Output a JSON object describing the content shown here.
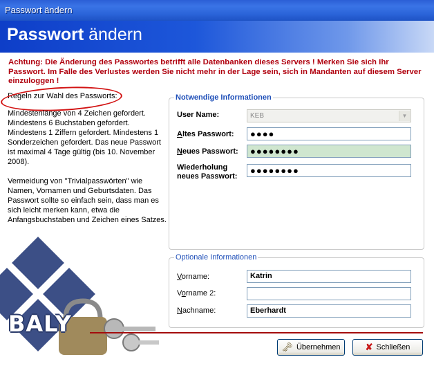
{
  "window": {
    "title": "Passwort ändern"
  },
  "header": {
    "title_bold": "Passwort",
    "title_rest": " ändern"
  },
  "warning": "Achtung: Die Änderung des Passwortes betrifft alle Datenbanken dieses Servers ! Merken Sie sich Ihr Passwort. Im Falle des Verlustes werden Sie nicht mehr in der Lage sein, sich in Mandanten auf diesem Server einzuloggen !",
  "rules": {
    "heading": "Regeln zur Wahl des Passworts:",
    "paragraph1": "Mindestenlänge von 4 Zeichen gefordert. Mindestens 6 Buchstaben gefordert. Mindestens 1 Ziffern gefordert. Mindestens 1 Sonderzeichen gefordert. Das neue Passwort ist maximal 4 Tage gültig (bis 10. November 2008).",
    "paragraph2": "Vermeidung von \"Trivialpasswörten\" wie Namen, Vornamen und Geburtsdaten. Das Passwort sollte so einfach sein, dass man es sich leicht merken kann, etwa die Anfangsbuchstaben und Zeichen eines Satzes."
  },
  "required": {
    "legend": "Notwendige Informationen",
    "username_label": "User Name:",
    "username_value": "KEB",
    "old_password_label": "Altes Passwort:",
    "old_password_mask": "●●●●",
    "new_password_label": "Neues Passwort:",
    "new_password_mask": "●●●●●●●●",
    "repeat_label_line1": "Wiederholung",
    "repeat_label_line2": "neues Passwort:",
    "repeat_mask": "●●●●●●●●"
  },
  "optional": {
    "legend": "Optionale Informationen",
    "firstname_label": "Vorname:",
    "firstname_value": "Katrin",
    "firstname2_label": "Vorname 2:",
    "firstname2_value": "",
    "lastname_label": "Nachname:",
    "lastname_value": "Eberhardt"
  },
  "buttons": {
    "apply_label": "Übernehmen",
    "close_label": "Schließen"
  },
  "logo": {
    "text": "BALY"
  },
  "colors": {
    "warning": "#b0000e",
    "legend": "#1f4fb8",
    "accent_line": "#a40c0c",
    "highlight_circle": "#d21313"
  }
}
